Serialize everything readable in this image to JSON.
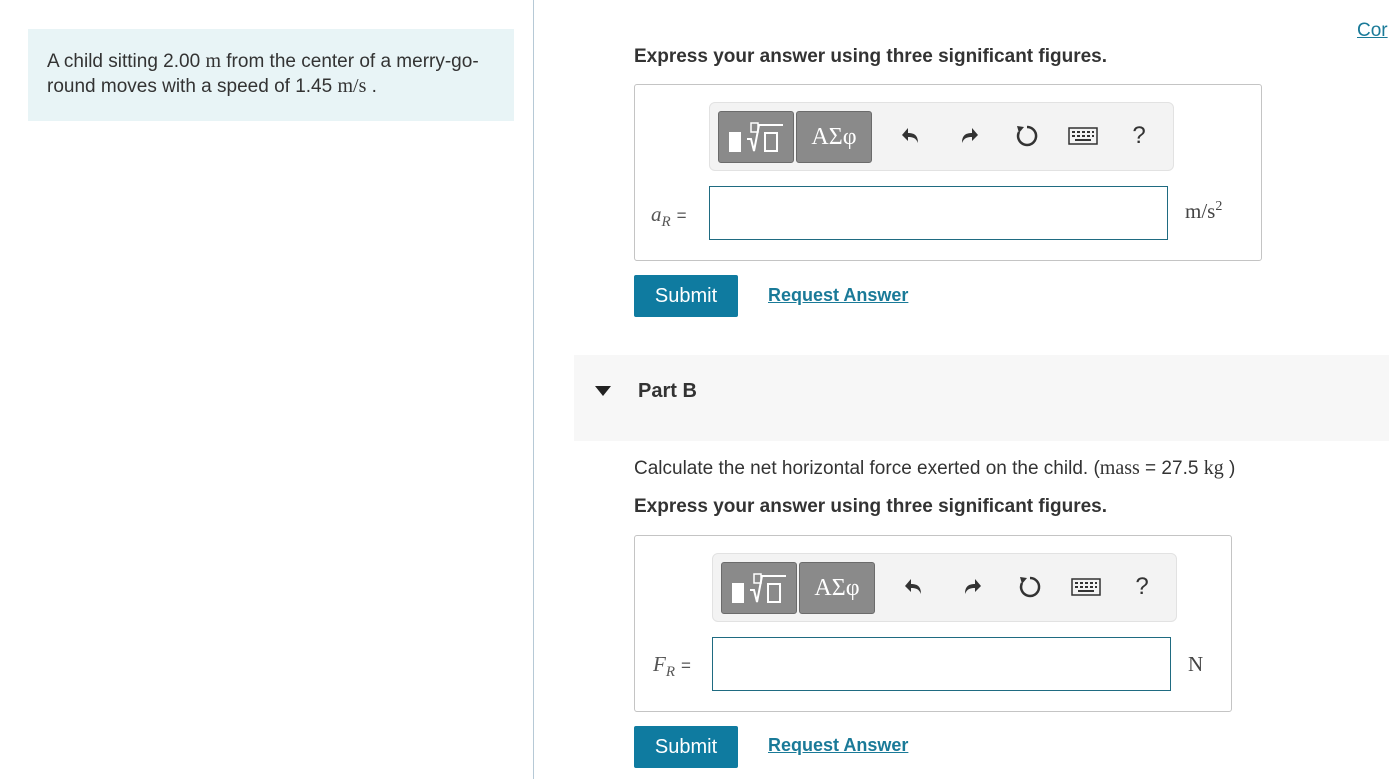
{
  "problem": {
    "text_before": "A child sitting 2.00",
    "unit_m": "m",
    "text_middle": " from the center of a merry-go-round moves with a speed of 1.45",
    "unit_speed": "m/s",
    "text_after": " ."
  },
  "corner_link": "Cor",
  "partA": {
    "instruction": "Express your answer using three significant figures.",
    "variable_main": "a",
    "variable_sub": "R",
    "equals": "=",
    "input_value": "",
    "unit_base": "m/s",
    "unit_sup": "2",
    "submit_label": "Submit",
    "request_label": "Request Answer"
  },
  "partB": {
    "title": "Part B",
    "question_text": "Calculate the net horizontal force exerted on the child. (",
    "question_math_label": "mass",
    "question_eq": " = 27.5 ",
    "question_unit": "kg",
    "question_close": " )",
    "instruction": "Express your answer using three significant figures.",
    "variable_main": "F",
    "variable_sub": "R",
    "equals": "=",
    "input_value": "",
    "unit": "N",
    "submit_label": "Submit",
    "request_label": "Request Answer"
  },
  "toolbar": {
    "symbols_label": "ΑΣφ",
    "help_label": "?",
    "icons": [
      "templates-icon",
      "undo-icon",
      "redo-icon",
      "reset-icon",
      "keyboard-icon",
      "help-icon"
    ]
  }
}
